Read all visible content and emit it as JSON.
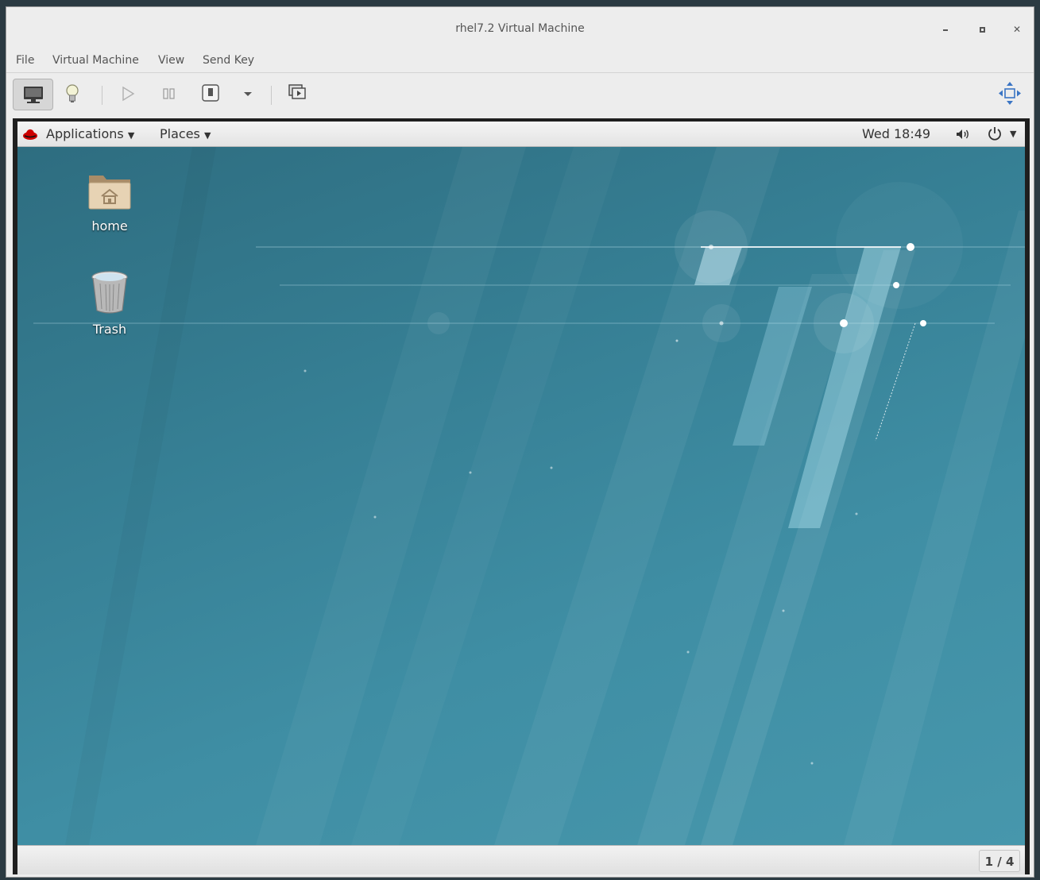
{
  "window": {
    "title": "rhel7.2 Virtual Machine"
  },
  "menubar": {
    "items": [
      "File",
      "Virtual Machine",
      "View",
      "Send Key"
    ]
  },
  "toolbar": {
    "buttons": [
      "console-view",
      "details-view",
      "run",
      "pause",
      "shutdown",
      "shutdown-menu",
      "snapshots",
      "fullscreen"
    ]
  },
  "guest": {
    "topbar": {
      "applications": "Applications",
      "places": "Places",
      "clock": "Wed 18:49"
    },
    "desktop_icons": [
      {
        "label": "home",
        "icon": "home-folder-icon"
      },
      {
        "label": "Trash",
        "icon": "trash-icon"
      }
    ],
    "workspace_indicator": "1 / 4"
  }
}
